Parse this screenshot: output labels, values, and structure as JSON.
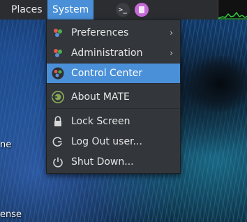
{
  "panel": {
    "places_label": "Places",
    "system_label": "System",
    "launchers": [
      {
        "icon": "terminal-icon",
        "glyph": ">_"
      },
      {
        "icon": "text-editor-icon"
      }
    ],
    "colors": {
      "panel_bg": "#2b2d31",
      "accent": "#4a90d9"
    }
  },
  "menu": {
    "items": [
      {
        "label": "Preferences",
        "icon": "preferences-icon",
        "submenu": true,
        "arrow": "›"
      },
      {
        "label": "Administration",
        "icon": "administration-icon",
        "submenu": true,
        "arrow": "›"
      },
      {
        "label": "Control Center",
        "icon": "control-center-icon",
        "highlighted": true
      },
      {
        "label": "About MATE",
        "icon": "mate-logo-icon"
      },
      {
        "label": "Lock Screen",
        "icon": "lock-icon"
      },
      {
        "label": "Log Out user...",
        "icon": "log-out-icon"
      },
      {
        "label": "Shut Down...",
        "icon": "power-icon"
      }
    ]
  },
  "desktop": {
    "labels": [
      "ne",
      "ense"
    ]
  }
}
